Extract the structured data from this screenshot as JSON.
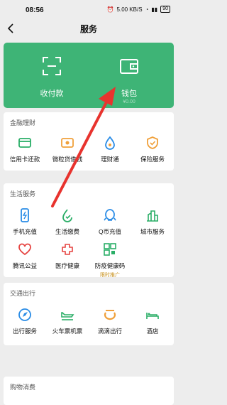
{
  "status": {
    "time": "08:56",
    "network": "5.00 KB/S",
    "battery": "90"
  },
  "nav": {
    "title": "服务"
  },
  "hero": {
    "left_label": "收付款",
    "right_label": "钱包",
    "right_sub": "¥0.00"
  },
  "sections": [
    {
      "title": "金融理财",
      "items": [
        {
          "label": "信用卡还款",
          "icon": "credit-card-icon"
        },
        {
          "label": "微粒贷借钱",
          "icon": "loan-icon"
        },
        {
          "label": "理财通",
          "icon": "wealth-icon"
        },
        {
          "label": "保险服务",
          "icon": "insurance-icon"
        }
      ]
    },
    {
      "title": "生活服务",
      "items": [
        {
          "label": "手机充值",
          "icon": "phone-recharge-icon"
        },
        {
          "label": "生活缴费",
          "icon": "utility-icon"
        },
        {
          "label": "Q币充值",
          "icon": "qq-icon"
        },
        {
          "label": "城市服务",
          "icon": "city-icon"
        },
        {
          "label": "腾讯公益",
          "icon": "charity-icon"
        },
        {
          "label": "医疗健康",
          "icon": "medical-icon"
        },
        {
          "label": "防疫健康码",
          "icon": "health-code-icon",
          "badge": "限时推广"
        }
      ]
    },
    {
      "title": "交通出行",
      "items": [
        {
          "label": "出行服务",
          "icon": "travel-icon"
        },
        {
          "label": "火车票机票",
          "icon": "train-icon"
        },
        {
          "label": "滴滴出行",
          "icon": "didi-icon"
        },
        {
          "label": "酒店",
          "icon": "hotel-icon"
        }
      ]
    },
    {
      "title": "购物消费",
      "items": []
    }
  ],
  "colors": {
    "accent": "#3eb476",
    "icon_green": "#2aae67",
    "icon_orange": "#f0a03a",
    "icon_blue": "#2a8ce6",
    "icon_red": "#e64340",
    "annotation": "#e8332e"
  }
}
